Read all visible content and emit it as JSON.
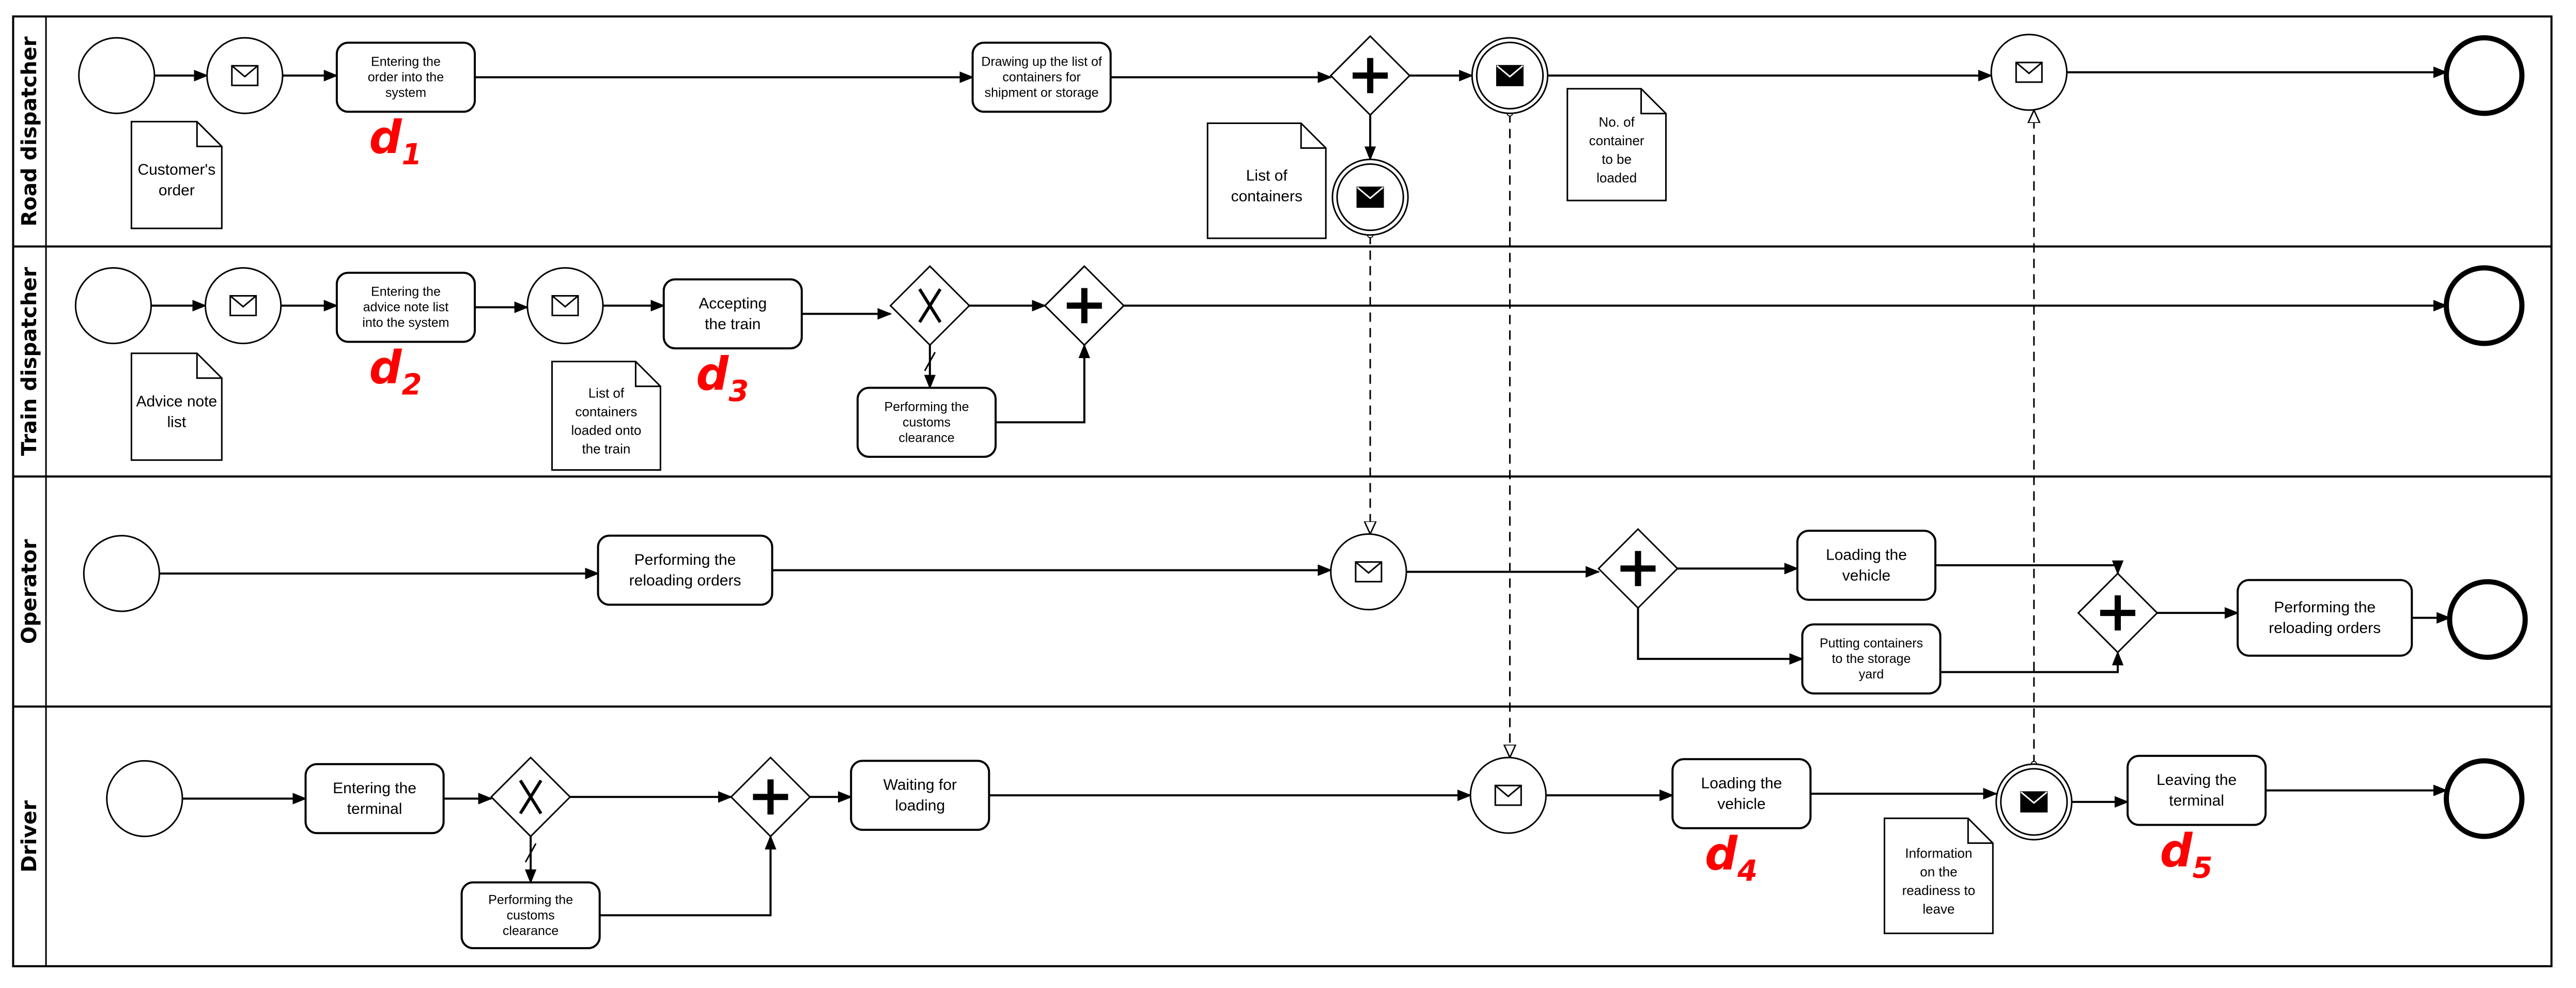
{
  "diagram": {
    "type": "BPMN collaboration / swimlane process",
    "lanes": [
      {
        "id": "road",
        "label": "Road dispatcher"
      },
      {
        "id": "train",
        "label": "Train dispatcher"
      },
      {
        "id": "operator",
        "label": "Operator"
      },
      {
        "id": "driver",
        "label": "Driver"
      }
    ],
    "tasks": [
      {
        "id": "t_r1",
        "lane": "road",
        "lines": [
          "Entering the",
          "order into the",
          "system"
        ]
      },
      {
        "id": "t_r2",
        "lane": "road",
        "lines": [
          "Drawing up the list of",
          "containers for",
          "shipment or storage"
        ]
      },
      {
        "id": "t_t1",
        "lane": "train",
        "lines": [
          "Entering the",
          "advice note list",
          "into the system"
        ]
      },
      {
        "id": "t_t2",
        "lane": "train",
        "lines": [
          "Accepting",
          "the train"
        ]
      },
      {
        "id": "t_t3",
        "lane": "train",
        "lines": [
          "Performing the",
          "customs",
          "clearance"
        ]
      },
      {
        "id": "t_o1",
        "lane": "operator",
        "lines": [
          "Performing the",
          "reloading orders"
        ]
      },
      {
        "id": "t_o2",
        "lane": "operator",
        "lines": [
          "Loading the",
          "vehicle"
        ]
      },
      {
        "id": "t_o3",
        "lane": "operator",
        "lines": [
          "Putting containers",
          "to the storage",
          "yard"
        ]
      },
      {
        "id": "t_o4",
        "lane": "operator",
        "lines": [
          "Performing the",
          "reloading orders"
        ]
      },
      {
        "id": "t_d1",
        "lane": "driver",
        "lines": [
          "Entering the",
          "terminal"
        ]
      },
      {
        "id": "t_d2",
        "lane": "driver",
        "lines": [
          "Performing the",
          "customs",
          "clearance"
        ]
      },
      {
        "id": "t_d3",
        "lane": "driver",
        "lines": [
          "Waiting for",
          "loading"
        ]
      },
      {
        "id": "t_d4",
        "lane": "driver",
        "lines": [
          "Loading the",
          "vehicle"
        ]
      },
      {
        "id": "t_d5",
        "lane": "driver",
        "lines": [
          "Leaving the",
          "terminal"
        ]
      }
    ],
    "annotations": [
      {
        "id": "n_r1",
        "lane": "road",
        "lines": [
          "Customer's",
          "order"
        ]
      },
      {
        "id": "n_r2",
        "lane": "road",
        "lines": [
          "List of",
          "containers"
        ]
      },
      {
        "id": "n_r3",
        "lane": "road",
        "lines": [
          "No. of",
          "container",
          "to be",
          "loaded"
        ]
      },
      {
        "id": "n_t1",
        "lane": "train",
        "lines": [
          "Advice note",
          "list"
        ]
      },
      {
        "id": "n_t2",
        "lane": "train",
        "lines": [
          "List of",
          "containers",
          "loaded onto",
          "the train"
        ]
      },
      {
        "id": "n_d1",
        "lane": "driver",
        "lines": [
          "Information",
          "on the",
          "readiness to",
          "leave"
        ]
      }
    ],
    "events": [
      {
        "id": "e_r_start",
        "kind": "start"
      },
      {
        "id": "e_r_msg1",
        "kind": "message-catch"
      },
      {
        "id": "e_r_throw1",
        "kind": "message-throw"
      },
      {
        "id": "e_r_throw2",
        "kind": "message-throw"
      },
      {
        "id": "e_r_msg2",
        "kind": "message-catch"
      },
      {
        "id": "e_r_end",
        "kind": "end"
      },
      {
        "id": "e_t_start",
        "kind": "start"
      },
      {
        "id": "e_t_msg1",
        "kind": "message-catch"
      },
      {
        "id": "e_t_msg2",
        "kind": "message-catch"
      },
      {
        "id": "e_t_end",
        "kind": "end"
      },
      {
        "id": "e_o_start",
        "kind": "start"
      },
      {
        "id": "e_o_msg1",
        "kind": "message-catch"
      },
      {
        "id": "e_o_end",
        "kind": "end"
      },
      {
        "id": "e_d_start",
        "kind": "start"
      },
      {
        "id": "e_d_msg1",
        "kind": "message-catch"
      },
      {
        "id": "e_d_throw1",
        "kind": "message-throw"
      },
      {
        "id": "e_d_end",
        "kind": "end"
      }
    ],
    "gateways": [
      {
        "id": "g_r1",
        "kind": "parallel"
      },
      {
        "id": "g_t1",
        "kind": "exclusive"
      },
      {
        "id": "g_t2",
        "kind": "parallel"
      },
      {
        "id": "g_o1",
        "kind": "parallel"
      },
      {
        "id": "g_o2",
        "kind": "parallel"
      },
      {
        "id": "g_d1",
        "kind": "exclusive"
      },
      {
        "id": "g_d2",
        "kind": "parallel"
      }
    ],
    "markers": [
      {
        "id": "m1",
        "base": "d",
        "sub": "1",
        "near": "t_r1"
      },
      {
        "id": "m2",
        "base": "d",
        "sub": "2",
        "near": "t_t1"
      },
      {
        "id": "m3",
        "base": "d",
        "sub": "3",
        "near": "t_t2"
      },
      {
        "id": "m4",
        "base": "d",
        "sub": "4",
        "near": "t_d4"
      },
      {
        "id": "m5",
        "base": "d",
        "sub": "5",
        "near": "t_d5"
      }
    ],
    "sequence_flows": [
      [
        "e_r_start",
        "e_r_msg1"
      ],
      [
        "e_r_msg1",
        "t_r1"
      ],
      [
        "t_r1",
        "t_r2"
      ],
      [
        "t_r2",
        "g_r1"
      ],
      [
        "g_r1",
        "e_r_throw1"
      ],
      [
        "g_r1",
        "e_r_throw2"
      ],
      [
        "e_r_throw1",
        "e_r_msg2"
      ],
      [
        "e_r_msg2",
        "e_r_end"
      ],
      [
        "e_t_start",
        "e_t_msg1"
      ],
      [
        "e_t_msg1",
        "t_t1"
      ],
      [
        "t_t1",
        "e_t_msg2"
      ],
      [
        "e_t_msg2",
        "t_t2"
      ],
      [
        "t_t2",
        "g_t1"
      ],
      [
        "g_t1",
        "g_t2"
      ],
      [
        "g_t1",
        "t_t3"
      ],
      [
        "t_t3",
        "g_t2"
      ],
      [
        "g_t2",
        "e_t_end"
      ],
      [
        "e_o_start",
        "t_o1"
      ],
      [
        "t_o1",
        "e_o_msg1"
      ],
      [
        "e_o_msg1",
        "g_o1"
      ],
      [
        "g_o1",
        "t_o2"
      ],
      [
        "g_o1",
        "t_o3"
      ],
      [
        "t_o2",
        "g_o2"
      ],
      [
        "t_o3",
        "g_o2"
      ],
      [
        "g_o2",
        "t_o4"
      ],
      [
        "t_o4",
        "e_o_end"
      ],
      [
        "e_d_start",
        "t_d1"
      ],
      [
        "t_d1",
        "g_d1"
      ],
      [
        "g_d1",
        "g_d2"
      ],
      [
        "g_d1",
        "t_d2"
      ],
      [
        "t_d2",
        "g_d2"
      ],
      [
        "g_d2",
        "t_d3"
      ],
      [
        "t_d3",
        "e_d_msg1"
      ],
      [
        "e_d_msg1",
        "t_d4"
      ],
      [
        "t_d4",
        "e_d_throw1"
      ],
      [
        "e_d_throw1",
        "t_d5"
      ],
      [
        "t_d5",
        "e_d_end"
      ]
    ],
    "message_flows": [
      [
        "e_r_throw2",
        "e_o_msg1"
      ],
      [
        "e_r_throw1",
        "e_d_msg1"
      ],
      [
        "e_d_throw1",
        "e_r_msg2"
      ]
    ],
    "colors": {
      "stroke": "#000000",
      "marker": "#ff0000",
      "background": "#ffffff"
    }
  }
}
